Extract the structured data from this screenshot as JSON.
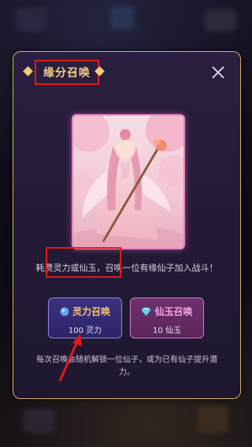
{
  "dialog": {
    "title": "缘分召唤",
    "close": "close"
  },
  "portrait": {
    "icon": "fairy-portrait-icon"
  },
  "description": "耗费灵力或仙玉，召唤一位有缘仙子加入战斗！",
  "buttons": {
    "spirit": {
      "label": "灵力召唤",
      "cost": "100 灵力",
      "icon": "spirit-orb-icon"
    },
    "jade": {
      "label": "仙玉召唤",
      "cost": "10 仙玉",
      "icon": "diamond-icon"
    }
  },
  "note": "每次召唤会随机解锁一位仙子，或为已有仙子提升潜力。",
  "colors": {
    "gold": "#f3cf85",
    "panel": "#261c38",
    "spirit_btn": "#332a73",
    "jade_btn": "#632a63",
    "annotation_red": "#e01a1a"
  }
}
